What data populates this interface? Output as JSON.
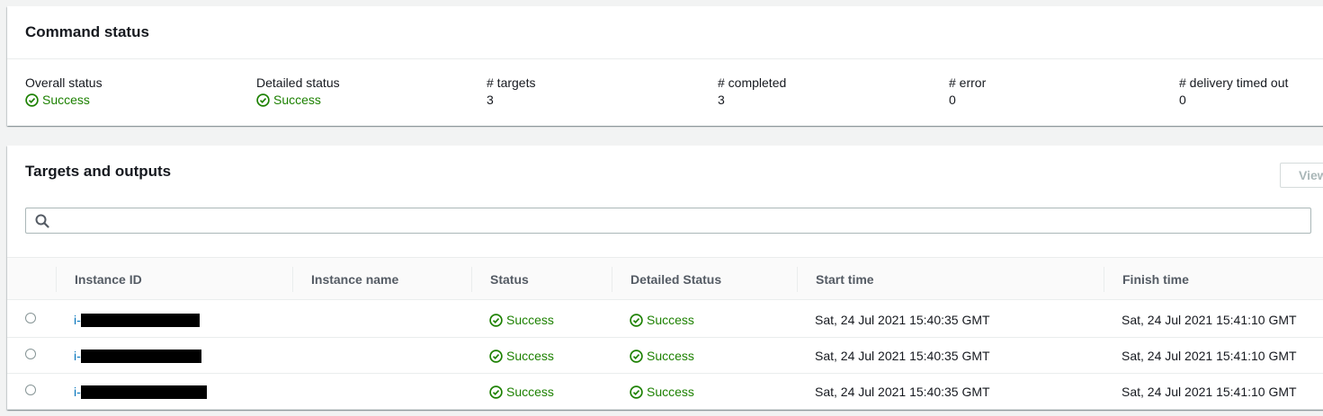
{
  "command_status": {
    "title": "Command status",
    "stats": [
      {
        "label": "Overall status",
        "value": "Success",
        "type": "success"
      },
      {
        "label": "Detailed status",
        "value": "Success",
        "type": "success"
      },
      {
        "label": "# targets",
        "value": "3",
        "type": "text"
      },
      {
        "label": "# completed",
        "value": "3",
        "type": "text"
      },
      {
        "label": "# error",
        "value": "0",
        "type": "text"
      },
      {
        "label": "# delivery timed out",
        "value": "0",
        "type": "text"
      }
    ]
  },
  "targets": {
    "title": "Targets and outputs",
    "view_button_label": "View",
    "search": {
      "value": "",
      "placeholder": ""
    },
    "columns": [
      "Instance ID",
      "Instance name",
      "Status",
      "Detailed Status",
      "Start time",
      "Finish time"
    ],
    "rows": [
      {
        "instance_id": "i-",
        "instance_name": "",
        "status": "Success",
        "detailed_status": "Success",
        "start_time": "Sat, 24 Jul 2021 15:40:35 GMT",
        "finish_time": "Sat, 24 Jul 2021 15:41:10 GMT"
      },
      {
        "instance_id": "i-",
        "instance_name": "",
        "status": "Success",
        "detailed_status": "Success",
        "start_time": "Sat, 24 Jul 2021 15:40:35 GMT",
        "finish_time": "Sat, 24 Jul 2021 15:41:10 GMT"
      },
      {
        "instance_id": "i-",
        "instance_name": "",
        "status": "Success",
        "detailed_status": "Success",
        "start_time": "Sat, 24 Jul 2021 15:40:35 GMT",
        "finish_time": "Sat, 24 Jul 2021 15:41:10 GMT"
      }
    ]
  },
  "colors": {
    "success": "#1d8102",
    "link": "#0073bb",
    "header_text": "#545b64"
  },
  "icons": {
    "success": "check-circle-icon",
    "search": "search-icon",
    "row_select": "radio-button"
  }
}
